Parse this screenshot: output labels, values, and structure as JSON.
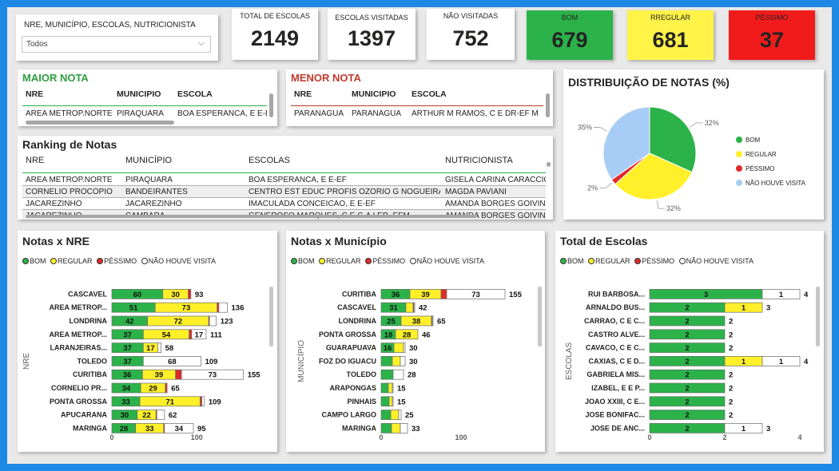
{
  "colors": {
    "bom": "#2bb34a",
    "regular": "#fff02a",
    "pessimo": "#e02a2a",
    "nao_visita": "#ffffff",
    "pie_nao_visita": "#a7cdf6",
    "kpi_green": "#2bb34a",
    "kpi_yellow": "#fff347",
    "kpi_red": "#f21b1b",
    "maior_title": "#2e9e3e",
    "menor_title": "#c0392b"
  },
  "filter": {
    "title": "NRE, MUNICÍPIO, ESCOLAS, NUTRICIONISTA",
    "value": "Todos"
  },
  "kpis": [
    {
      "label": "TOTAL DE ESCOLAS",
      "value": "2149"
    },
    {
      "label": "ESCOLAS VISITADAS",
      "value": "1397"
    },
    {
      "label": "NÃO VISITADAS",
      "value": "752"
    },
    {
      "label": "BOM",
      "value": "679"
    },
    {
      "label": "RREGULAR",
      "value": "681"
    },
    {
      "label": "PÉSSIMO",
      "value": "37"
    }
  ],
  "maior_nota": {
    "title": "MAIOR NOTA",
    "headers": [
      "NRE",
      "MUNICIPIO",
      "ESCOLA"
    ],
    "row": [
      "AREA METROP.NORTE",
      "PIRAQUARA",
      "BOA ESPERANCA, E E-EF"
    ]
  },
  "menor_nota": {
    "title": "MENOR NOTA",
    "headers": [
      "NRE",
      "MUNICIPIO",
      "ESCOLA"
    ],
    "row": [
      "PARANAGUA",
      "PARANAGUA",
      "ARTHUR M RAMOS, C E DR-EF M"
    ]
  },
  "ranking": {
    "title": "Ranking de Notas",
    "headers": [
      "NRE",
      "MUNICÍPIO",
      "ESCOLAS",
      "NUTRICIONISTA"
    ],
    "rows": [
      [
        "AREA METROP.NORTE",
        "PIRAQUARA",
        "BOA ESPERANCA, E E-EF",
        "GISELA CARINA CARACCIOLO"
      ],
      [
        "CORNELIO PROCOPIO",
        "BANDEIRANTES",
        "CENTRO EST EDUC PROFIS OZORIO G NOGUEIRA",
        "MAGDA PAVIANI"
      ],
      [
        "JACAREZINHO",
        "JACAREZINHO",
        "IMACULADA CONCEICAO, E E-EF",
        "AMANDA BORGES GOIVINHO"
      ],
      [
        "JACAREZINHO",
        "CAMBARA",
        "GENEROSO MARQUES, C E C-A LEP- EFM",
        "AMANDA BORGES GOIVINHO"
      ]
    ]
  },
  "legend": {
    "bom": "BOM",
    "regular": "REGULAR",
    "pessimo": "PÉSSIMO",
    "nao_visita": "NÃO HOUVE VISITA"
  },
  "pie": {
    "title": "DISTRIBUIÇÃO DE NOTAS (%)",
    "legend": [
      "BOM",
      "REGULAR",
      "PÉSSIMO",
      "NÃO HOUVE VISITA"
    ]
  },
  "chart_data": [
    {
      "type": "pie",
      "title": "DISTRIBUIÇÃO DE NOTAS (%)",
      "categories": [
        "BOM",
        "REGULAR",
        "PÉSSIMO",
        "NÃO HOUVE VISITA"
      ],
      "values": [
        32,
        32,
        2,
        35
      ],
      "labels": [
        "32%",
        "32%",
        "2%",
        "35%"
      ]
    },
    {
      "type": "bar",
      "title": "Notas x NRE",
      "ylabel": "NRE",
      "categories": [
        "CASCAVEL",
        "AREA METROP...",
        "LONDRINA",
        "AREA METROP...",
        "LARANJEIRAS...",
        "TOLEDO",
        "CURITIBA",
        "CORNELIO PR...",
        "PONTA GROSSA",
        "APUCARANA",
        "MARINGA"
      ],
      "series": [
        {
          "name": "BOM",
          "values": [
            60,
            51,
            42,
            37,
            37,
            37,
            36,
            34,
            33,
            30,
            28
          ]
        },
        {
          "name": "REGULAR",
          "values": [
            30,
            73,
            72,
            54,
            17,
            0,
            39,
            29,
            71,
            22,
            33
          ]
        },
        {
          "name": "PÉSSIMO",
          "values": [
            3,
            2,
            1,
            3,
            0,
            0,
            7,
            2,
            2,
            1,
            1
          ]
        },
        {
          "name": "NÃO HOUVE VISITA",
          "values": [
            0,
            10,
            8,
            17,
            4,
            68,
            73,
            0,
            3,
            9,
            34
          ]
        }
      ],
      "value_labels": [
        [
          60,
          30,
          null,
          null
        ],
        [
          51,
          73,
          null,
          null
        ],
        [
          42,
          72,
          null,
          null
        ],
        [
          37,
          54,
          null,
          17
        ],
        [
          37,
          17,
          null,
          null
        ],
        [
          37,
          null,
          null,
          68
        ],
        [
          36,
          39,
          null,
          73
        ],
        [
          34,
          29,
          null,
          null
        ],
        [
          33,
          71,
          null,
          null
        ],
        [
          30,
          22,
          null,
          null
        ],
        [
          28,
          33,
          null,
          34
        ]
      ],
      "totals": [
        93,
        136,
        123,
        111,
        58,
        109,
        155,
        65,
        109,
        62,
        95
      ],
      "xticks": [
        "0",
        "100"
      ],
      "xlim": [
        0,
        160
      ]
    },
    {
      "type": "bar",
      "title": "Notas x Município",
      "ylabel": "MUNICÍPIO",
      "categories": [
        "CURITIBA",
        "CASCAVEL",
        "LONDRINA",
        "PONTA GROSSA",
        "GUARAPUAVA",
        "FOZ DO IGUACU",
        "TOLEDO",
        "ARAPONGAS",
        "PINHAIS",
        "CAMPO LARGO",
        "MARINGA"
      ],
      "series": [
        {
          "name": "BOM",
          "values": [
            36,
            31,
            25,
            18,
            16,
            14,
            15,
            9,
            10,
            12,
            13
          ]
        },
        {
          "name": "REGULAR",
          "values": [
            39,
            9,
            38,
            28,
            12,
            10,
            0,
            5,
            4,
            10,
            11
          ]
        },
        {
          "name": "PÉSSIMO",
          "values": [
            7,
            1,
            1,
            0,
            0,
            0,
            0,
            0,
            0,
            0,
            0
          ]
        },
        {
          "name": "NÃO HOUVE VISITA",
          "values": [
            73,
            1,
            1,
            0,
            2,
            6,
            13,
            1,
            1,
            3,
            9
          ]
        }
      ],
      "value_labels": [
        [
          36,
          39,
          null,
          73
        ],
        [
          31,
          null,
          null,
          null
        ],
        [
          25,
          38,
          null,
          null
        ],
        [
          18,
          28,
          null,
          null
        ],
        [
          16,
          null,
          null,
          null
        ],
        [
          null,
          null,
          null,
          null
        ],
        [
          null,
          null,
          null,
          null
        ],
        [
          null,
          null,
          null,
          null
        ],
        [
          null,
          null,
          null,
          null
        ],
        [
          null,
          null,
          null,
          null
        ],
        [
          null,
          null,
          null,
          null
        ]
      ],
      "totals": [
        155,
        42,
        65,
        46,
        30,
        30,
        28,
        15,
        15,
        25,
        33
      ],
      "xticks": [
        "0",
        "100"
      ],
      "xlim": [
        0,
        160
      ]
    },
    {
      "type": "bar",
      "title": "Total de Escolas",
      "ylabel": "ESCOLAS",
      "categories": [
        "RUI BARBOSA...",
        "ARNALDO BUS...",
        "CARRAO, C E C...",
        "CASTRO ALVE...",
        "CAVACO, C E C...",
        "CAXIAS, C E D...",
        "GABRIELA MIS...",
        "IZABEL, E E P...",
        "JOAO XXIII, C E...",
        "JOSE BONIFAC...",
        "JOSE DE ANC..."
      ],
      "series": [
        {
          "name": "BOM",
          "values": [
            3,
            2,
            2,
            2,
            2,
            2,
            2,
            2,
            2,
            2,
            2
          ]
        },
        {
          "name": "REGULAR",
          "values": [
            0,
            1,
            0,
            0,
            0,
            1,
            0,
            0,
            0,
            0,
            0
          ]
        },
        {
          "name": "PÉSSIMO",
          "values": [
            0,
            0,
            0,
            0,
            0,
            0,
            0,
            0,
            0,
            0,
            0
          ]
        },
        {
          "name": "NÃO HOUVE VISITA",
          "values": [
            1,
            0,
            0,
            0,
            0,
            1,
            0,
            0,
            0,
            0,
            1
          ]
        }
      ],
      "value_labels": [
        [
          3,
          null,
          null,
          1
        ],
        [
          2,
          1,
          null,
          null
        ],
        [
          2,
          null,
          null,
          null
        ],
        [
          2,
          null,
          null,
          null
        ],
        [
          2,
          null,
          null,
          null
        ],
        [
          2,
          1,
          null,
          1
        ],
        [
          2,
          null,
          null,
          null
        ],
        [
          2,
          null,
          null,
          null
        ],
        [
          2,
          null,
          null,
          null
        ],
        [
          2,
          null,
          null,
          null
        ],
        [
          2,
          null,
          null,
          1
        ]
      ],
      "totals": [
        4,
        3,
        2,
        2,
        2,
        4,
        2,
        2,
        2,
        2,
        3
      ],
      "xticks": [
        "0",
        "2",
        "4"
      ],
      "xlim": [
        0,
        4
      ]
    }
  ]
}
